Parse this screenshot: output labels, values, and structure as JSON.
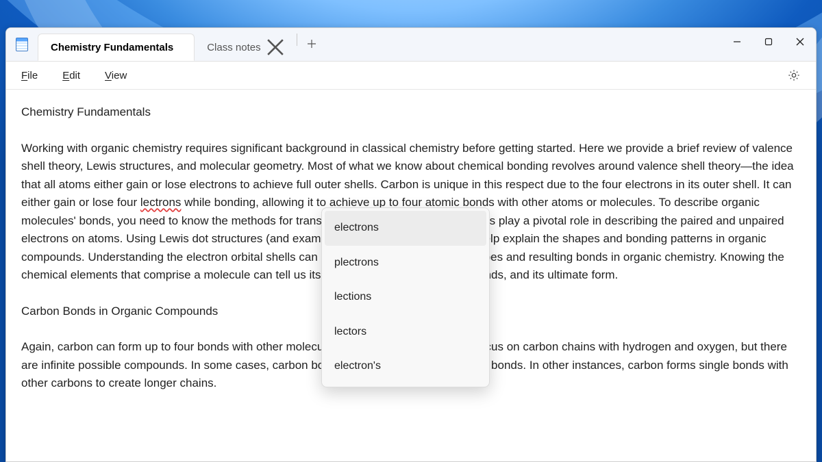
{
  "tabs": {
    "active": "Chemistry Fundamentals",
    "inactive": "Class notes"
  },
  "menubar": {
    "file": "File",
    "edit": "Edit",
    "view": "View"
  },
  "document": {
    "title": "Chemistry Fundamentals",
    "para1_before_misspell": "Working with organic chemistry requires significant background in classical chemistry before getting started. Here we provide a brief review of valence shell theory, Lewis structures, and molecular geometry. Most of what we know about chemical bonding revolves around valence shell theory—the idea that all atoms either gain or lose electrons to achieve full outer shells. Carbon is unique in this respect due to the four electrons in its outer shell. It can either gain or lose four ",
    "misspelled": "lectrons",
    "para1_after_misspell": " while bonding, allowing it to achieve up to four atomic bonds with other atoms or molecules. To describe organic molecules' bonds, you need to know the methods for transcribing them. Lewis dot structures play a pivotal role in describing the paired and unpaired electrons on atoms. Using Lewis dot structures (and examining resonant structures) can help explain the shapes and bonding patterns in organic compounds. Understanding the electron orbital shells can help illuminate the eventual shapes and resulting bonds in organic chemistry. Knowing the chemical elements that comprise a molecule can tell us its basic shape, the angle of its bonds, and its ultimate form.",
    "heading2": "Carbon Bonds in Organic Compounds",
    "para2": "Again, carbon can form up to four bonds with other molecules. In this course, we mainly focus on carbon chains with hydrogen and oxygen, but there are infinite possible compounds. In some cases, carbon bonds with four hydrogen in single bonds. In other instances, carbon forms single bonds with other carbons to create longer chains."
  },
  "suggestions": {
    "items": [
      "electrons",
      "plectrons",
      "lections",
      "lectors",
      "electron's"
    ],
    "hover_index": 0
  }
}
